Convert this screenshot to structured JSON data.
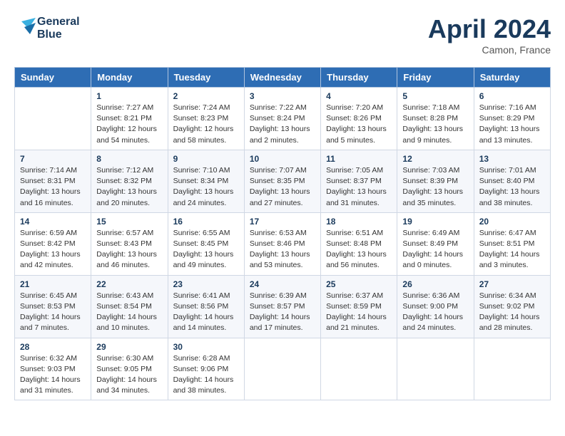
{
  "header": {
    "logo_line1": "General",
    "logo_line2": "Blue",
    "month": "April 2024",
    "location": "Camon, France"
  },
  "days_of_week": [
    "Sunday",
    "Monday",
    "Tuesday",
    "Wednesday",
    "Thursday",
    "Friday",
    "Saturday"
  ],
  "weeks": [
    [
      {
        "day": "",
        "info": ""
      },
      {
        "day": "1",
        "info": "Sunrise: 7:27 AM\nSunset: 8:21 PM\nDaylight: 12 hours\nand 54 minutes."
      },
      {
        "day": "2",
        "info": "Sunrise: 7:24 AM\nSunset: 8:23 PM\nDaylight: 12 hours\nand 58 minutes."
      },
      {
        "day": "3",
        "info": "Sunrise: 7:22 AM\nSunset: 8:24 PM\nDaylight: 13 hours\nand 2 minutes."
      },
      {
        "day": "4",
        "info": "Sunrise: 7:20 AM\nSunset: 8:26 PM\nDaylight: 13 hours\nand 5 minutes."
      },
      {
        "day": "5",
        "info": "Sunrise: 7:18 AM\nSunset: 8:28 PM\nDaylight: 13 hours\nand 9 minutes."
      },
      {
        "day": "6",
        "info": "Sunrise: 7:16 AM\nSunset: 8:29 PM\nDaylight: 13 hours\nand 13 minutes."
      }
    ],
    [
      {
        "day": "7",
        "info": "Sunrise: 7:14 AM\nSunset: 8:31 PM\nDaylight: 13 hours\nand 16 minutes."
      },
      {
        "day": "8",
        "info": "Sunrise: 7:12 AM\nSunset: 8:32 PM\nDaylight: 13 hours\nand 20 minutes."
      },
      {
        "day": "9",
        "info": "Sunrise: 7:10 AM\nSunset: 8:34 PM\nDaylight: 13 hours\nand 24 minutes."
      },
      {
        "day": "10",
        "info": "Sunrise: 7:07 AM\nSunset: 8:35 PM\nDaylight: 13 hours\nand 27 minutes."
      },
      {
        "day": "11",
        "info": "Sunrise: 7:05 AM\nSunset: 8:37 PM\nDaylight: 13 hours\nand 31 minutes."
      },
      {
        "day": "12",
        "info": "Sunrise: 7:03 AM\nSunset: 8:39 PM\nDaylight: 13 hours\nand 35 minutes."
      },
      {
        "day": "13",
        "info": "Sunrise: 7:01 AM\nSunset: 8:40 PM\nDaylight: 13 hours\nand 38 minutes."
      }
    ],
    [
      {
        "day": "14",
        "info": "Sunrise: 6:59 AM\nSunset: 8:42 PM\nDaylight: 13 hours\nand 42 minutes."
      },
      {
        "day": "15",
        "info": "Sunrise: 6:57 AM\nSunset: 8:43 PM\nDaylight: 13 hours\nand 46 minutes."
      },
      {
        "day": "16",
        "info": "Sunrise: 6:55 AM\nSunset: 8:45 PM\nDaylight: 13 hours\nand 49 minutes."
      },
      {
        "day": "17",
        "info": "Sunrise: 6:53 AM\nSunset: 8:46 PM\nDaylight: 13 hours\nand 53 minutes."
      },
      {
        "day": "18",
        "info": "Sunrise: 6:51 AM\nSunset: 8:48 PM\nDaylight: 13 hours\nand 56 minutes."
      },
      {
        "day": "19",
        "info": "Sunrise: 6:49 AM\nSunset: 8:49 PM\nDaylight: 14 hours\nand 0 minutes."
      },
      {
        "day": "20",
        "info": "Sunrise: 6:47 AM\nSunset: 8:51 PM\nDaylight: 14 hours\nand 3 minutes."
      }
    ],
    [
      {
        "day": "21",
        "info": "Sunrise: 6:45 AM\nSunset: 8:53 PM\nDaylight: 14 hours\nand 7 minutes."
      },
      {
        "day": "22",
        "info": "Sunrise: 6:43 AM\nSunset: 8:54 PM\nDaylight: 14 hours\nand 10 minutes."
      },
      {
        "day": "23",
        "info": "Sunrise: 6:41 AM\nSunset: 8:56 PM\nDaylight: 14 hours\nand 14 minutes."
      },
      {
        "day": "24",
        "info": "Sunrise: 6:39 AM\nSunset: 8:57 PM\nDaylight: 14 hours\nand 17 minutes."
      },
      {
        "day": "25",
        "info": "Sunrise: 6:37 AM\nSunset: 8:59 PM\nDaylight: 14 hours\nand 21 minutes."
      },
      {
        "day": "26",
        "info": "Sunrise: 6:36 AM\nSunset: 9:00 PM\nDaylight: 14 hours\nand 24 minutes."
      },
      {
        "day": "27",
        "info": "Sunrise: 6:34 AM\nSunset: 9:02 PM\nDaylight: 14 hours\nand 28 minutes."
      }
    ],
    [
      {
        "day": "28",
        "info": "Sunrise: 6:32 AM\nSunset: 9:03 PM\nDaylight: 14 hours\nand 31 minutes."
      },
      {
        "day": "29",
        "info": "Sunrise: 6:30 AM\nSunset: 9:05 PM\nDaylight: 14 hours\nand 34 minutes."
      },
      {
        "day": "30",
        "info": "Sunrise: 6:28 AM\nSunset: 9:06 PM\nDaylight: 14 hours\nand 38 minutes."
      },
      {
        "day": "",
        "info": ""
      },
      {
        "day": "",
        "info": ""
      },
      {
        "day": "",
        "info": ""
      },
      {
        "day": "",
        "info": ""
      }
    ]
  ]
}
